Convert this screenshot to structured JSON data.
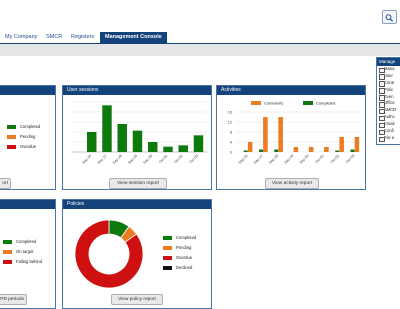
{
  "nav": {
    "tabs": [
      {
        "label": "My Company"
      },
      {
        "label": "SMCR"
      },
      {
        "label": "Registers"
      },
      {
        "label": "Management Console"
      }
    ]
  },
  "panels": {
    "left_top": {
      "button": "ort",
      "legend": [
        "Completed",
        "Pending",
        "Overdue"
      ]
    },
    "user_sessions": {
      "title": "User sessions",
      "button": "View session report"
    },
    "activities": {
      "title": "Activities",
      "button": "View activity report"
    },
    "left_bottom": {
      "button": "us CPD periods",
      "legend": [
        "Completed",
        "On target",
        "Falling behind"
      ]
    },
    "policies": {
      "title": "Policies",
      "button": "View policy report",
      "legend": [
        "Completed",
        "Pending",
        "Overdue",
        "Declined"
      ]
    }
  },
  "sidebar": {
    "title": "Manage",
    "items": [
      "Mana",
      "User",
      "Contr",
      "Polic",
      "Even",
      "Office",
      "SMCR",
      "Authc",
      "Email",
      "Confi",
      "File e"
    ]
  },
  "colors": {
    "navy": "#14427a",
    "green": "#0e7a0e",
    "orange": "#ec7c22",
    "red": "#cf1010",
    "black": "#111111"
  },
  "chart_data": [
    {
      "type": "bar",
      "title": "User sessions",
      "categories": [
        "Sep 26",
        "Sep 27",
        "Sep 28",
        "Sep 29",
        "Sep 30",
        "Oct 01",
        "Oct 02",
        "Oct 03"
      ],
      "series": [
        {
          "values": [
            30,
            70,
            42,
            32,
            15,
            8,
            10,
            25
          ]
        }
      ],
      "ylim": [
        0,
        75
      ],
      "grid": true
    },
    {
      "type": "bar",
      "title": "Activities",
      "yticks": [
        "0",
        "4",
        "8",
        "12",
        "16"
      ],
      "categories": [
        "Sep 26",
        "Sep 27",
        "Sep 28",
        "Sep 29",
        "Sep 30",
        "Oct 01",
        "Oct 02",
        "Oct 03"
      ],
      "series": [
        {
          "name": "Comments",
          "values": [
            4,
            14,
            14,
            2,
            2,
            2,
            6,
            6
          ]
        },
        {
          "name": "Completed",
          "values": [
            0.6,
            1,
            1,
            0,
            0,
            0,
            0.6,
            1
          ]
        }
      ],
      "ylim": [
        0,
        16
      ],
      "grid": true,
      "legend": "top"
    },
    {
      "type": "pie",
      "title": "Policies",
      "donut": true,
      "labels": [
        "Completed",
        "Pending",
        "Overdue",
        "Declined"
      ],
      "values": [
        10,
        5,
        85,
        0
      ]
    }
  ]
}
